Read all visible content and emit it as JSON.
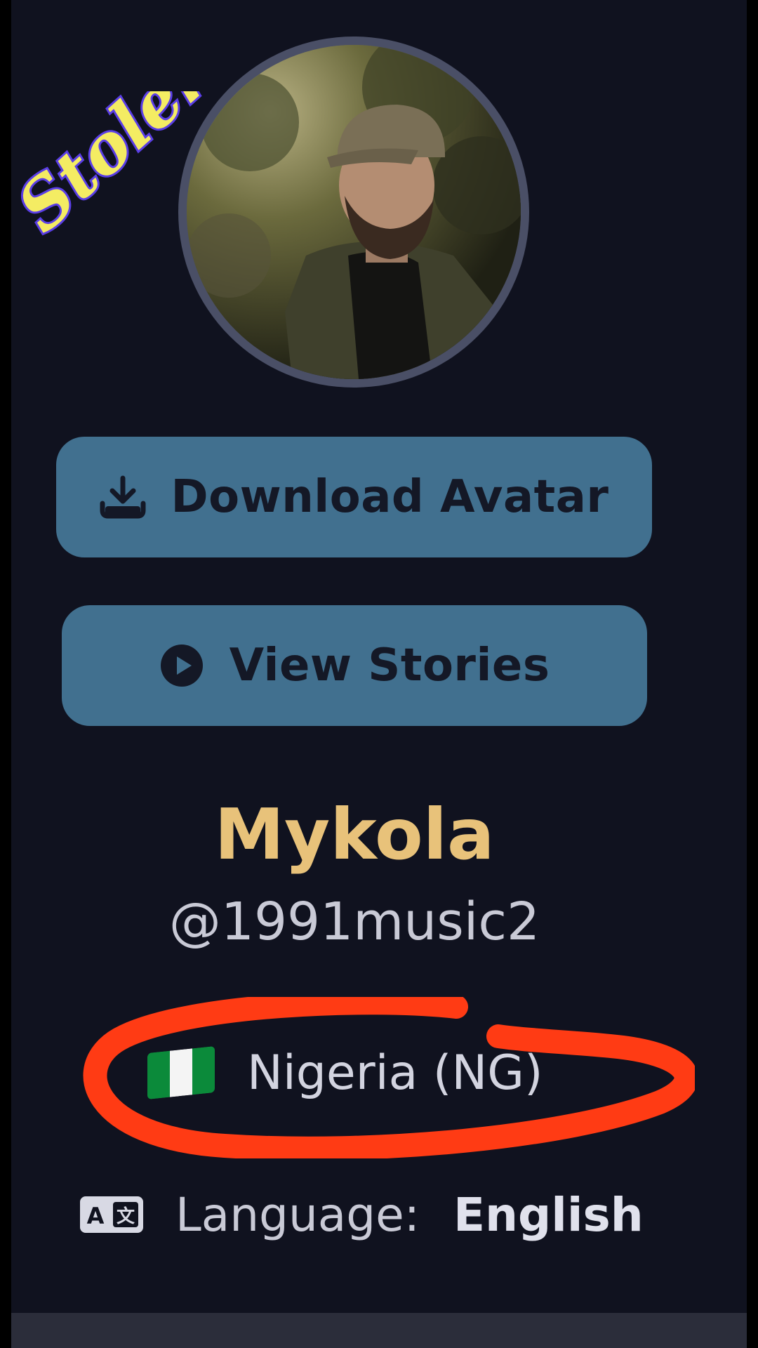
{
  "watermark": {
    "text": "Stolen",
    "color": "#f4ec63",
    "outline": "#5a3ee6"
  },
  "profile": {
    "display_name": "Mykola",
    "username": "@1991music2",
    "country": {
      "flag_icon": "nigeria-flag-icon",
      "label": "Nigeria (NG)"
    },
    "language": {
      "icon": "translate-icon",
      "label": "Language:",
      "value": "English"
    }
  },
  "actions": {
    "download": {
      "icon": "download-icon",
      "label": "Download Avatar"
    },
    "stories": {
      "icon": "play-circle-icon",
      "label": "View Stories"
    }
  },
  "colors": {
    "background": "#10121f",
    "button": "#41708f",
    "name": "#e8c27a",
    "annotation": "#ff3b14"
  }
}
